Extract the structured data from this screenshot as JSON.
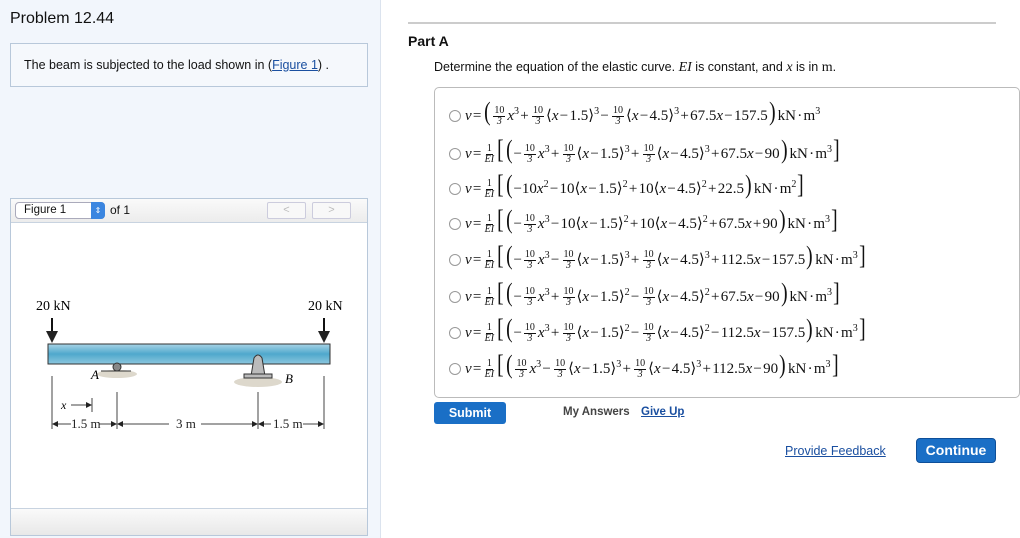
{
  "problem_title": "Problem 12.44",
  "intro": {
    "text_before": "The beam is subjected to the load shown in (",
    "link": "Figure 1",
    "text_after": ") ."
  },
  "figure_panel": {
    "select_value": "Figure 1",
    "of_label": "of 1",
    "prev": "<",
    "next": ">",
    "diagram": {
      "load_left": "20 kN",
      "load_right": "20 kN",
      "support_a": "A",
      "support_b": "B",
      "x_label": "x",
      "dim1": "1.5 m",
      "dim2": "3 m",
      "dim3": "1.5 m"
    }
  },
  "part": {
    "label": "Part A",
    "question_pre": "Determine the equation of the elastic curve. ",
    "question_ei": "EI",
    "question_mid": " is constant, and ",
    "question_x": "x",
    "question_post": " is in ",
    "question_m": "m",
    "question_end": "."
  },
  "options": [
    "v = ({10/3}x^3 + {10/3}⟨x − 1.5⟩^3 − {10/3}⟨x − 4.5⟩^3 + 67.5x − 157.5) kN · m^3",
    "v = {1/EI}[(−{10/3}x^3 + {10/3}⟨x − 1.5⟩^3 + {10/3}⟨x − 4.5⟩^3 + 67.5x − 90) kN · m^3]",
    "v = {1/EI}[(−10x^2 − 10⟨x − 1.5⟩^2 + 10⟨x − 4.5⟩^2 + 22.5) kN · m^2]",
    "v = {1/EI}[(−{10/3}x^3 − 10⟨x − 1.5⟩^2 + 10⟨x − 4.5⟩^2 + 67.5x + 90) kN · m^3]",
    "v = {1/EI}[(−{10/3}x^3 − {10/3}⟨x − 1.5⟩^3 + {10/3}⟨x − 4.5⟩^3 + 112.5x − 157.5) kN · m^3]",
    "v = {1/EI}[(−{10/3}x^3 + {10/3}⟨x − 1.5⟩^2 − {10/3}⟨x − 4.5⟩^2 + 67.5x − 90) kN · m^3]",
    "v = {1/EI}[(−{10/3}x^3 + {10/3}⟨x − 1.5⟩^2 − {10/3}⟨x − 4.5⟩^2 − 112.5x − 157.5) kN · m^3]",
    "v = {1/EI}[({10/3}x^3 − {10/3}⟨x − 1.5⟩^3 + {10/3}⟨x − 4.5⟩^3 + 112.5x − 90) kN · m^3]"
  ],
  "actions": {
    "submit": "Submit",
    "my_answers": "My Answers",
    "give_up": "Give Up",
    "provide_feedback": "Provide Feedback",
    "continue": "Continue"
  }
}
